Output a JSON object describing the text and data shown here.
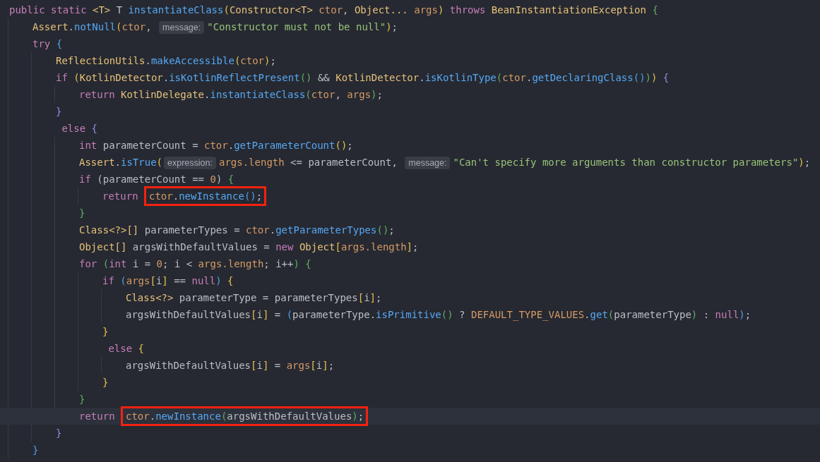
{
  "lines": [
    {
      "current": false,
      "segments": [
        {
          "kind": "keyword",
          "text": "public static "
        },
        {
          "kind": "type",
          "text": "<T>"
        },
        {
          "kind": "plain",
          "text": " T "
        },
        {
          "kind": "method",
          "text": "instantiateClass"
        },
        {
          "kind": "bracket-1",
          "text": "("
        },
        {
          "kind": "type",
          "text": "Constructor<T> "
        },
        {
          "kind": "param",
          "text": "ctor"
        },
        {
          "kind": "plain",
          "text": ", "
        },
        {
          "kind": "type",
          "text": "Object... "
        },
        {
          "kind": "param",
          "text": "args"
        },
        {
          "kind": "bracket-1",
          "text": ")"
        },
        {
          "kind": "keyword",
          "text": " throws "
        },
        {
          "kind": "type",
          "text": "BeanInstantiationException "
        },
        {
          "kind": "bracket-3",
          "text": "{"
        }
      ],
      "children": [
        {
          "current": false,
          "segments": [
            {
              "kind": "type",
              "text": "Assert"
            },
            {
              "kind": "plain",
              "text": "."
            },
            {
              "kind": "method",
              "text": "notNull"
            },
            {
              "kind": "bracket-1",
              "text": "("
            },
            {
              "kind": "param",
              "text": "ctor"
            },
            {
              "kind": "plain",
              "text": ", "
            },
            {
              "kind": "hint",
              "text": "message:"
            },
            {
              "kind": "string",
              "text": "\"Constructor must not be null\""
            },
            {
              "kind": "bracket-1",
              "text": ")"
            },
            {
              "kind": "plain",
              "text": ";"
            }
          ]
        },
        {
          "current": false,
          "segments": [
            {
              "kind": "keyword",
              "text": "try "
            },
            {
              "kind": "bracket-4",
              "text": "{"
            }
          ],
          "children": [
            {
              "current": false,
              "segments": [
                {
                  "kind": "type",
                  "text": "ReflectionUtils"
                },
                {
                  "kind": "plain",
                  "text": "."
                },
                {
                  "kind": "method",
                  "text": "makeAccessible"
                },
                {
                  "kind": "bracket-1",
                  "text": "("
                },
                {
                  "kind": "param",
                  "text": "ctor"
                },
                {
                  "kind": "bracket-1",
                  "text": ")"
                },
                {
                  "kind": "plain",
                  "text": ";"
                }
              ]
            },
            {
              "current": false,
              "segments": [
                {
                  "kind": "keyword",
                  "text": "if "
                },
                {
                  "kind": "bracket-1",
                  "text": "("
                },
                {
                  "kind": "type",
                  "text": "KotlinDetector"
                },
                {
                  "kind": "plain",
                  "text": "."
                },
                {
                  "kind": "method",
                  "text": "isKotlinReflectPresent"
                },
                {
                  "kind": "bracket-3",
                  "text": "()"
                },
                {
                  "kind": "plain",
                  "text": " && "
                },
                {
                  "kind": "type",
                  "text": "KotlinDetector"
                },
                {
                  "kind": "plain",
                  "text": "."
                },
                {
                  "kind": "method",
                  "text": "isKotlinType"
                },
                {
                  "kind": "bracket-3",
                  "text": "("
                },
                {
                  "kind": "param",
                  "text": "ctor"
                },
                {
                  "kind": "plain",
                  "text": "."
                },
                {
                  "kind": "method",
                  "text": "getDeclaringClass"
                },
                {
                  "kind": "bracket-4",
                  "text": "()"
                },
                {
                  "kind": "bracket-3",
                  "text": ")"
                },
                {
                  "kind": "bracket-1",
                  "text": ")"
                },
                {
                  "kind": "bracket-2",
                  "text": " {"
                }
              ],
              "children": [
                {
                  "current": false,
                  "segments": [
                    {
                      "kind": "keyword",
                      "text": "return "
                    },
                    {
                      "kind": "type",
                      "text": "KotlinDelegate"
                    },
                    {
                      "kind": "plain",
                      "text": "."
                    },
                    {
                      "kind": "method",
                      "text": "instantiateClass"
                    },
                    {
                      "kind": "bracket-3",
                      "text": "("
                    },
                    {
                      "kind": "param",
                      "text": "ctor"
                    },
                    {
                      "kind": "plain",
                      "text": ", "
                    },
                    {
                      "kind": "param",
                      "text": "args"
                    },
                    {
                      "kind": "bracket-3",
                      "text": ")"
                    },
                    {
                      "kind": "plain",
                      "text": ";"
                    }
                  ]
                }
              ]
            },
            {
              "current": false,
              "segments": [
                {
                  "kind": "bracket-2",
                  "text": "}"
                }
              ]
            },
            {
              "current": false,
              "segments": [
                {
                  "kind": "keyword",
                  "text": " else "
                },
                {
                  "kind": "bracket-2",
                  "text": "{"
                }
              ],
              "children": [
                {
                  "current": false,
                  "segments": [
                    {
                      "kind": "keyword",
                      "text": "int "
                    },
                    {
                      "kind": "plain",
                      "text": "parameterCount = "
                    },
                    {
                      "kind": "param",
                      "text": "ctor"
                    },
                    {
                      "kind": "plain",
                      "text": "."
                    },
                    {
                      "kind": "method",
                      "text": "getParameterCount"
                    },
                    {
                      "kind": "bracket-1",
                      "text": "()"
                    },
                    {
                      "kind": "plain",
                      "text": ";"
                    }
                  ]
                },
                {
                  "current": false,
                  "segments": [
                    {
                      "kind": "type",
                      "text": "Assert"
                    },
                    {
                      "kind": "plain",
                      "text": "."
                    },
                    {
                      "kind": "method",
                      "text": "isTrue"
                    },
                    {
                      "kind": "bracket-1",
                      "text": "("
                    },
                    {
                      "kind": "hint",
                      "text": "expression:"
                    },
                    {
                      "kind": "param",
                      "text": "args.length"
                    },
                    {
                      "kind": "plain",
                      "text": " <= parameterCount, "
                    },
                    {
                      "kind": "hint",
                      "text": "message:"
                    },
                    {
                      "kind": "string",
                      "text": "\"Can't specify more arguments than constructor parameters\""
                    },
                    {
                      "kind": "bracket-1",
                      "text": ")"
                    },
                    {
                      "kind": "plain",
                      "text": ";"
                    }
                  ]
                },
                {
                  "current": false,
                  "segments": [
                    {
                      "kind": "keyword",
                      "text": "if "
                    },
                    {
                      "kind": "plain",
                      "text": "(parameterCount == "
                    },
                    {
                      "kind": "number",
                      "text": "0"
                    },
                    {
                      "kind": "plain",
                      "text": ")"
                    },
                    {
                      "kind": "bracket-3",
                      "text": " {"
                    }
                  ],
                  "children": [
                    {
                      "current": false,
                      "segments": [
                        {
                          "kind": "keyword",
                          "text": "return "
                        },
                        {
                          "kind": "callout",
                          "segments": [
                            {
                              "kind": "param",
                              "text": "ctor"
                            },
                            {
                              "kind": "plain",
                              "text": "."
                            },
                            {
                              "kind": "method",
                              "text": "newInstance"
                            },
                            {
                              "kind": "bracket-4",
                              "text": "()"
                            },
                            {
                              "kind": "plain",
                              "text": ";"
                            }
                          ]
                        }
                      ]
                    }
                  ]
                },
                {
                  "current": false,
                  "segments": [
                    {
                      "kind": "bracket-3",
                      "text": "}"
                    }
                  ]
                },
                {
                  "current": false,
                  "segments": [
                    {
                      "kind": "type",
                      "text": "Class<?>[] "
                    },
                    {
                      "kind": "plain",
                      "text": "parameterTypes = "
                    },
                    {
                      "kind": "param",
                      "text": "ctor"
                    },
                    {
                      "kind": "plain",
                      "text": "."
                    },
                    {
                      "kind": "method",
                      "text": "getParameterTypes"
                    },
                    {
                      "kind": "bracket-3",
                      "text": "()"
                    },
                    {
                      "kind": "plain",
                      "text": ";"
                    }
                  ]
                },
                {
                  "current": false,
                  "segments": [
                    {
                      "kind": "type",
                      "text": "Object[] "
                    },
                    {
                      "kind": "plain",
                      "text": "argsWithDefaultValues = "
                    },
                    {
                      "kind": "keyword",
                      "text": "new "
                    },
                    {
                      "kind": "type",
                      "text": "Object"
                    },
                    {
                      "kind": "bracket-1",
                      "text": "["
                    },
                    {
                      "kind": "param",
                      "text": "args.length"
                    },
                    {
                      "kind": "bracket-1",
                      "text": "]"
                    },
                    {
                      "kind": "plain",
                      "text": ";"
                    }
                  ]
                },
                {
                  "current": false,
                  "segments": [
                    {
                      "kind": "keyword",
                      "text": "for "
                    },
                    {
                      "kind": "bracket-3",
                      "text": "("
                    },
                    {
                      "kind": "keyword",
                      "text": "int "
                    },
                    {
                      "kind": "plain",
                      "text": "i = "
                    },
                    {
                      "kind": "number",
                      "text": "0"
                    },
                    {
                      "kind": "plain",
                      "text": "; i < "
                    },
                    {
                      "kind": "param",
                      "text": "args.length"
                    },
                    {
                      "kind": "plain",
                      "text": "; i++"
                    },
                    {
                      "kind": "bracket-3",
                      "text": ")"
                    },
                    {
                      "kind": "bracket-3",
                      "text": " {"
                    }
                  ],
                  "children": [
                    {
                      "current": false,
                      "segments": [
                        {
                          "kind": "keyword",
                          "text": "if "
                        },
                        {
                          "kind": "bracket-4",
                          "text": "("
                        },
                        {
                          "kind": "param",
                          "text": "args"
                        },
                        {
                          "kind": "bracket-1",
                          "text": "["
                        },
                        {
                          "kind": "plain",
                          "text": "i"
                        },
                        {
                          "kind": "bracket-1",
                          "text": "]"
                        },
                        {
                          "kind": "plain",
                          "text": " == "
                        },
                        {
                          "kind": "keyword",
                          "text": "null"
                        },
                        {
                          "kind": "bracket-4",
                          "text": ")"
                        },
                        {
                          "kind": "bracket-1",
                          "text": " {"
                        }
                      ],
                      "children": [
                        {
                          "current": false,
                          "segments": [
                            {
                              "kind": "type",
                              "text": "Class<?> "
                            },
                            {
                              "kind": "plain",
                              "text": "parameterType = parameterTypes"
                            },
                            {
                              "kind": "bracket-1",
                              "text": "["
                            },
                            {
                              "kind": "plain",
                              "text": "i"
                            },
                            {
                              "kind": "bracket-1",
                              "text": "]"
                            },
                            {
                              "kind": "plain",
                              "text": ";"
                            }
                          ]
                        },
                        {
                          "current": false,
                          "segments": [
                            {
                              "kind": "plain",
                              "text": "argsWithDefaultValues"
                            },
                            {
                              "kind": "bracket-1",
                              "text": "["
                            },
                            {
                              "kind": "plain",
                              "text": "i"
                            },
                            {
                              "kind": "bracket-1",
                              "text": "]"
                            },
                            {
                              "kind": "plain",
                              "text": " = "
                            },
                            {
                              "kind": "bracket-4",
                              "text": "("
                            },
                            {
                              "kind": "plain",
                              "text": "parameterType."
                            },
                            {
                              "kind": "method",
                              "text": "isPrimitive"
                            },
                            {
                              "kind": "bracket-3",
                              "text": "()"
                            },
                            {
                              "kind": "plain",
                              "text": " ? "
                            },
                            {
                              "kind": "param",
                              "text": "DEFAULT_TYPE_VALUES"
                            },
                            {
                              "kind": "plain",
                              "text": "."
                            },
                            {
                              "kind": "method",
                              "text": "get"
                            },
                            {
                              "kind": "bracket-3",
                              "text": "("
                            },
                            {
                              "kind": "plain",
                              "text": "parameterType"
                            },
                            {
                              "kind": "bracket-3",
                              "text": ")"
                            },
                            {
                              "kind": "plain",
                              "text": " : "
                            },
                            {
                              "kind": "keyword",
                              "text": "null"
                            },
                            {
                              "kind": "bracket-4",
                              "text": ")"
                            },
                            {
                              "kind": "plain",
                              "text": ";"
                            }
                          ]
                        }
                      ]
                    },
                    {
                      "current": false,
                      "segments": [
                        {
                          "kind": "bracket-1",
                          "text": "}"
                        }
                      ]
                    },
                    {
                      "current": false,
                      "segments": [
                        {
                          "kind": "keyword",
                          "text": " else "
                        },
                        {
                          "kind": "bracket-1",
                          "text": "{"
                        }
                      ],
                      "children": [
                        {
                          "current": false,
                          "segments": [
                            {
                              "kind": "plain",
                              "text": "argsWithDefaultValues"
                            },
                            {
                              "kind": "bracket-1",
                              "text": "["
                            },
                            {
                              "kind": "plain",
                              "text": "i"
                            },
                            {
                              "kind": "bracket-1",
                              "text": "]"
                            },
                            {
                              "kind": "plain",
                              "text": " = "
                            },
                            {
                              "kind": "param",
                              "text": "args"
                            },
                            {
                              "kind": "bracket-1",
                              "text": "["
                            },
                            {
                              "kind": "plain",
                              "text": "i"
                            },
                            {
                              "kind": "bracket-1",
                              "text": "]"
                            },
                            {
                              "kind": "plain",
                              "text": ";"
                            }
                          ]
                        }
                      ]
                    },
                    {
                      "current": false,
                      "segments": [
                        {
                          "kind": "bracket-1",
                          "text": "}"
                        }
                      ]
                    }
                  ]
                },
                {
                  "current": false,
                  "segments": [
                    {
                      "kind": "bracket-3",
                      "text": "}"
                    }
                  ]
                },
                {
                  "current": true,
                  "segments": [
                    {
                      "kind": "keyword",
                      "text": "return "
                    },
                    {
                      "kind": "callout",
                      "segments": [
                        {
                          "kind": "param",
                          "text": "ctor"
                        },
                        {
                          "kind": "plain",
                          "text": "."
                        },
                        {
                          "kind": "method",
                          "text": "newInstance"
                        },
                        {
                          "kind": "bracket-3",
                          "text": "("
                        },
                        {
                          "kind": "plain",
                          "text": "argsWithDefaultValues"
                        },
                        {
                          "kind": "bracket-3",
                          "text": ")"
                        },
                        {
                          "kind": "plain",
                          "text": ";"
                        }
                      ]
                    }
                  ]
                }
              ]
            },
            {
              "current": false,
              "segments": [
                {
                  "kind": "bracket-2",
                  "text": "}"
                }
              ]
            }
          ]
        },
        {
          "current": false,
          "segments": [
            {
              "kind": "bracket-4",
              "text": "}"
            }
          ]
        }
      ]
    }
  ]
}
